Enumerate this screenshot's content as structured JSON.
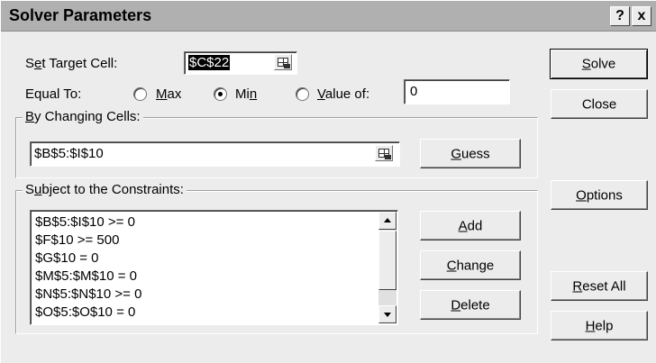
{
  "window": {
    "title": "Solver Parameters",
    "help_glyph": "?",
    "close_glyph": "x"
  },
  "target": {
    "label_pre": "S",
    "label_accel": "e",
    "label_post": "t Target Cell:",
    "value": "$C$22",
    "ref_icon": "range-selector-icon"
  },
  "equal_to": {
    "label": "Equal To:",
    "options": [
      {
        "pre": "",
        "accel": "M",
        "post": "ax",
        "selected": false
      },
      {
        "pre": "Mi",
        "accel": "n",
        "post": "",
        "selected": true
      },
      {
        "pre": "",
        "accel": "V",
        "post": "alue of:",
        "selected": false
      }
    ],
    "value_of": "0"
  },
  "changing": {
    "title_pre": "",
    "title_accel": "B",
    "title_post": "y Changing Cells:",
    "value": "$B$5:$I$10",
    "guess": {
      "pre": "",
      "accel": "G",
      "post": "uess"
    }
  },
  "constraints": {
    "title_pre": "S",
    "title_accel": "u",
    "title_post": "bject to the Constraints:",
    "items": [
      "$B$5:$I$10 >= 0",
      "$F$10 >= 500",
      "$G$10 = 0",
      "$M$5:$M$10 = 0",
      "$N$5:$N$10 >= 0",
      "$O$5:$O$10 = 0"
    ],
    "buttons": {
      "add": {
        "pre": "",
        "accel": "A",
        "post": "dd"
      },
      "change": {
        "pre": "",
        "accel": "C",
        "post": "hange"
      },
      "delete": {
        "pre": "",
        "accel": "D",
        "post": "elete"
      }
    }
  },
  "side_buttons": {
    "solve": {
      "pre": "",
      "accel": "S",
      "post": "olve"
    },
    "close": "Close",
    "options": {
      "pre": "",
      "accel": "O",
      "post": "ptions"
    },
    "reset": {
      "pre": "",
      "accel": "R",
      "post": "eset All"
    },
    "help": {
      "pre": "",
      "accel": "H",
      "post": "elp"
    }
  }
}
